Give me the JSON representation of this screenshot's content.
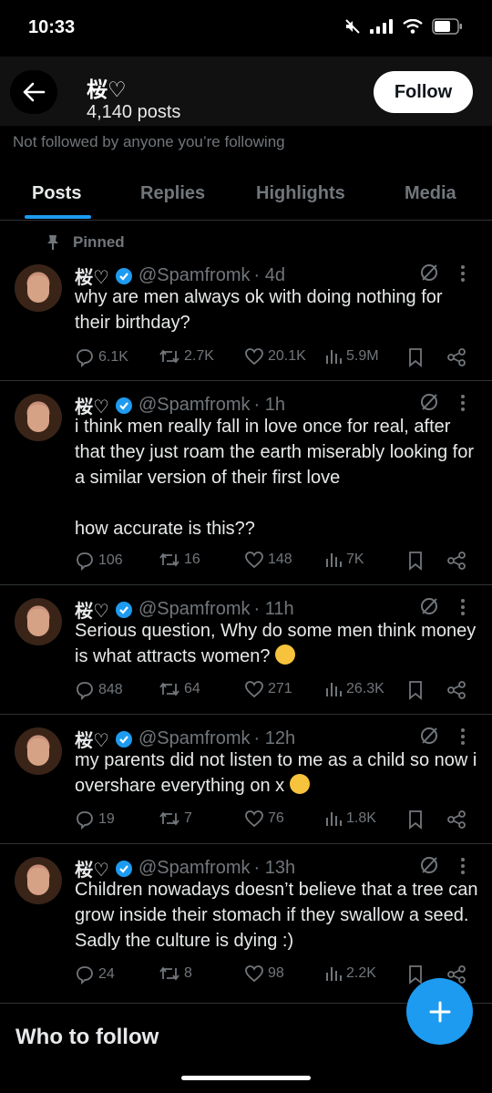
{
  "status_bar": {
    "time": "10:33"
  },
  "header": {
    "name": "桜♡",
    "post_count": "4,140 posts",
    "follow_label": "Follow"
  },
  "not_followed": "Not followed by anyone you’re following",
  "tabs": [
    {
      "label": "Posts",
      "active": true
    },
    {
      "label": "Replies",
      "active": false
    },
    {
      "label": "Highlights",
      "active": false
    },
    {
      "label": "Media",
      "active": false
    }
  ],
  "pinned_label": "Pinned",
  "tweets": [
    {
      "name": "桜♡",
      "handle": "@Spamfromk",
      "time": "· 4d",
      "text": "why are men always ok with doing nothing for their birthday?",
      "replies": "6.1K",
      "reposts": "2.7K",
      "likes": "20.1K",
      "views": "5.9M"
    },
    {
      "name": "桜♡",
      "handle": "@Spamfromk",
      "time": "· 1h",
      "text": "i think men really fall in love once for real, after that they just roam the earth miserably looking for a similar version of their first love\n\nhow accurate is this??",
      "replies": "106",
      "reposts": "16",
      "likes": "148",
      "views": "7K"
    },
    {
      "name": "桜♡",
      "handle": "@Spamfromk",
      "time": "· 11h",
      "text": "Serious question, Why do some men think money is what attracts women?",
      "emoji": "thinking-face-emoji",
      "replies": "848",
      "reposts": "64",
      "likes": "271",
      "views": "26.3K"
    },
    {
      "name": "桜♡",
      "handle": "@Spamfromk",
      "time": "· 12h",
      "text": "my parents did not listen to me as a child so now i overshare everything on x",
      "emoji": "loudly-crying-face-emoji",
      "replies": "19",
      "reposts": "7",
      "likes": "76",
      "views": "1.8K"
    },
    {
      "name": "桜♡",
      "handle": "@Spamfromk",
      "time": "· 13h",
      "text": "Children nowadays doesn’t believe that a tree can grow inside their stomach if they swallow a seed. Sadly the culture is dying :)",
      "replies": "24",
      "reposts": "8",
      "likes": "98",
      "views": "2.2K"
    }
  ],
  "who_to_follow": "Who to follow",
  "colors": {
    "accent": "#1d9bf0",
    "background": "#000000",
    "secondary_text": "#71767b",
    "primary_text": "#e7e9ea"
  }
}
